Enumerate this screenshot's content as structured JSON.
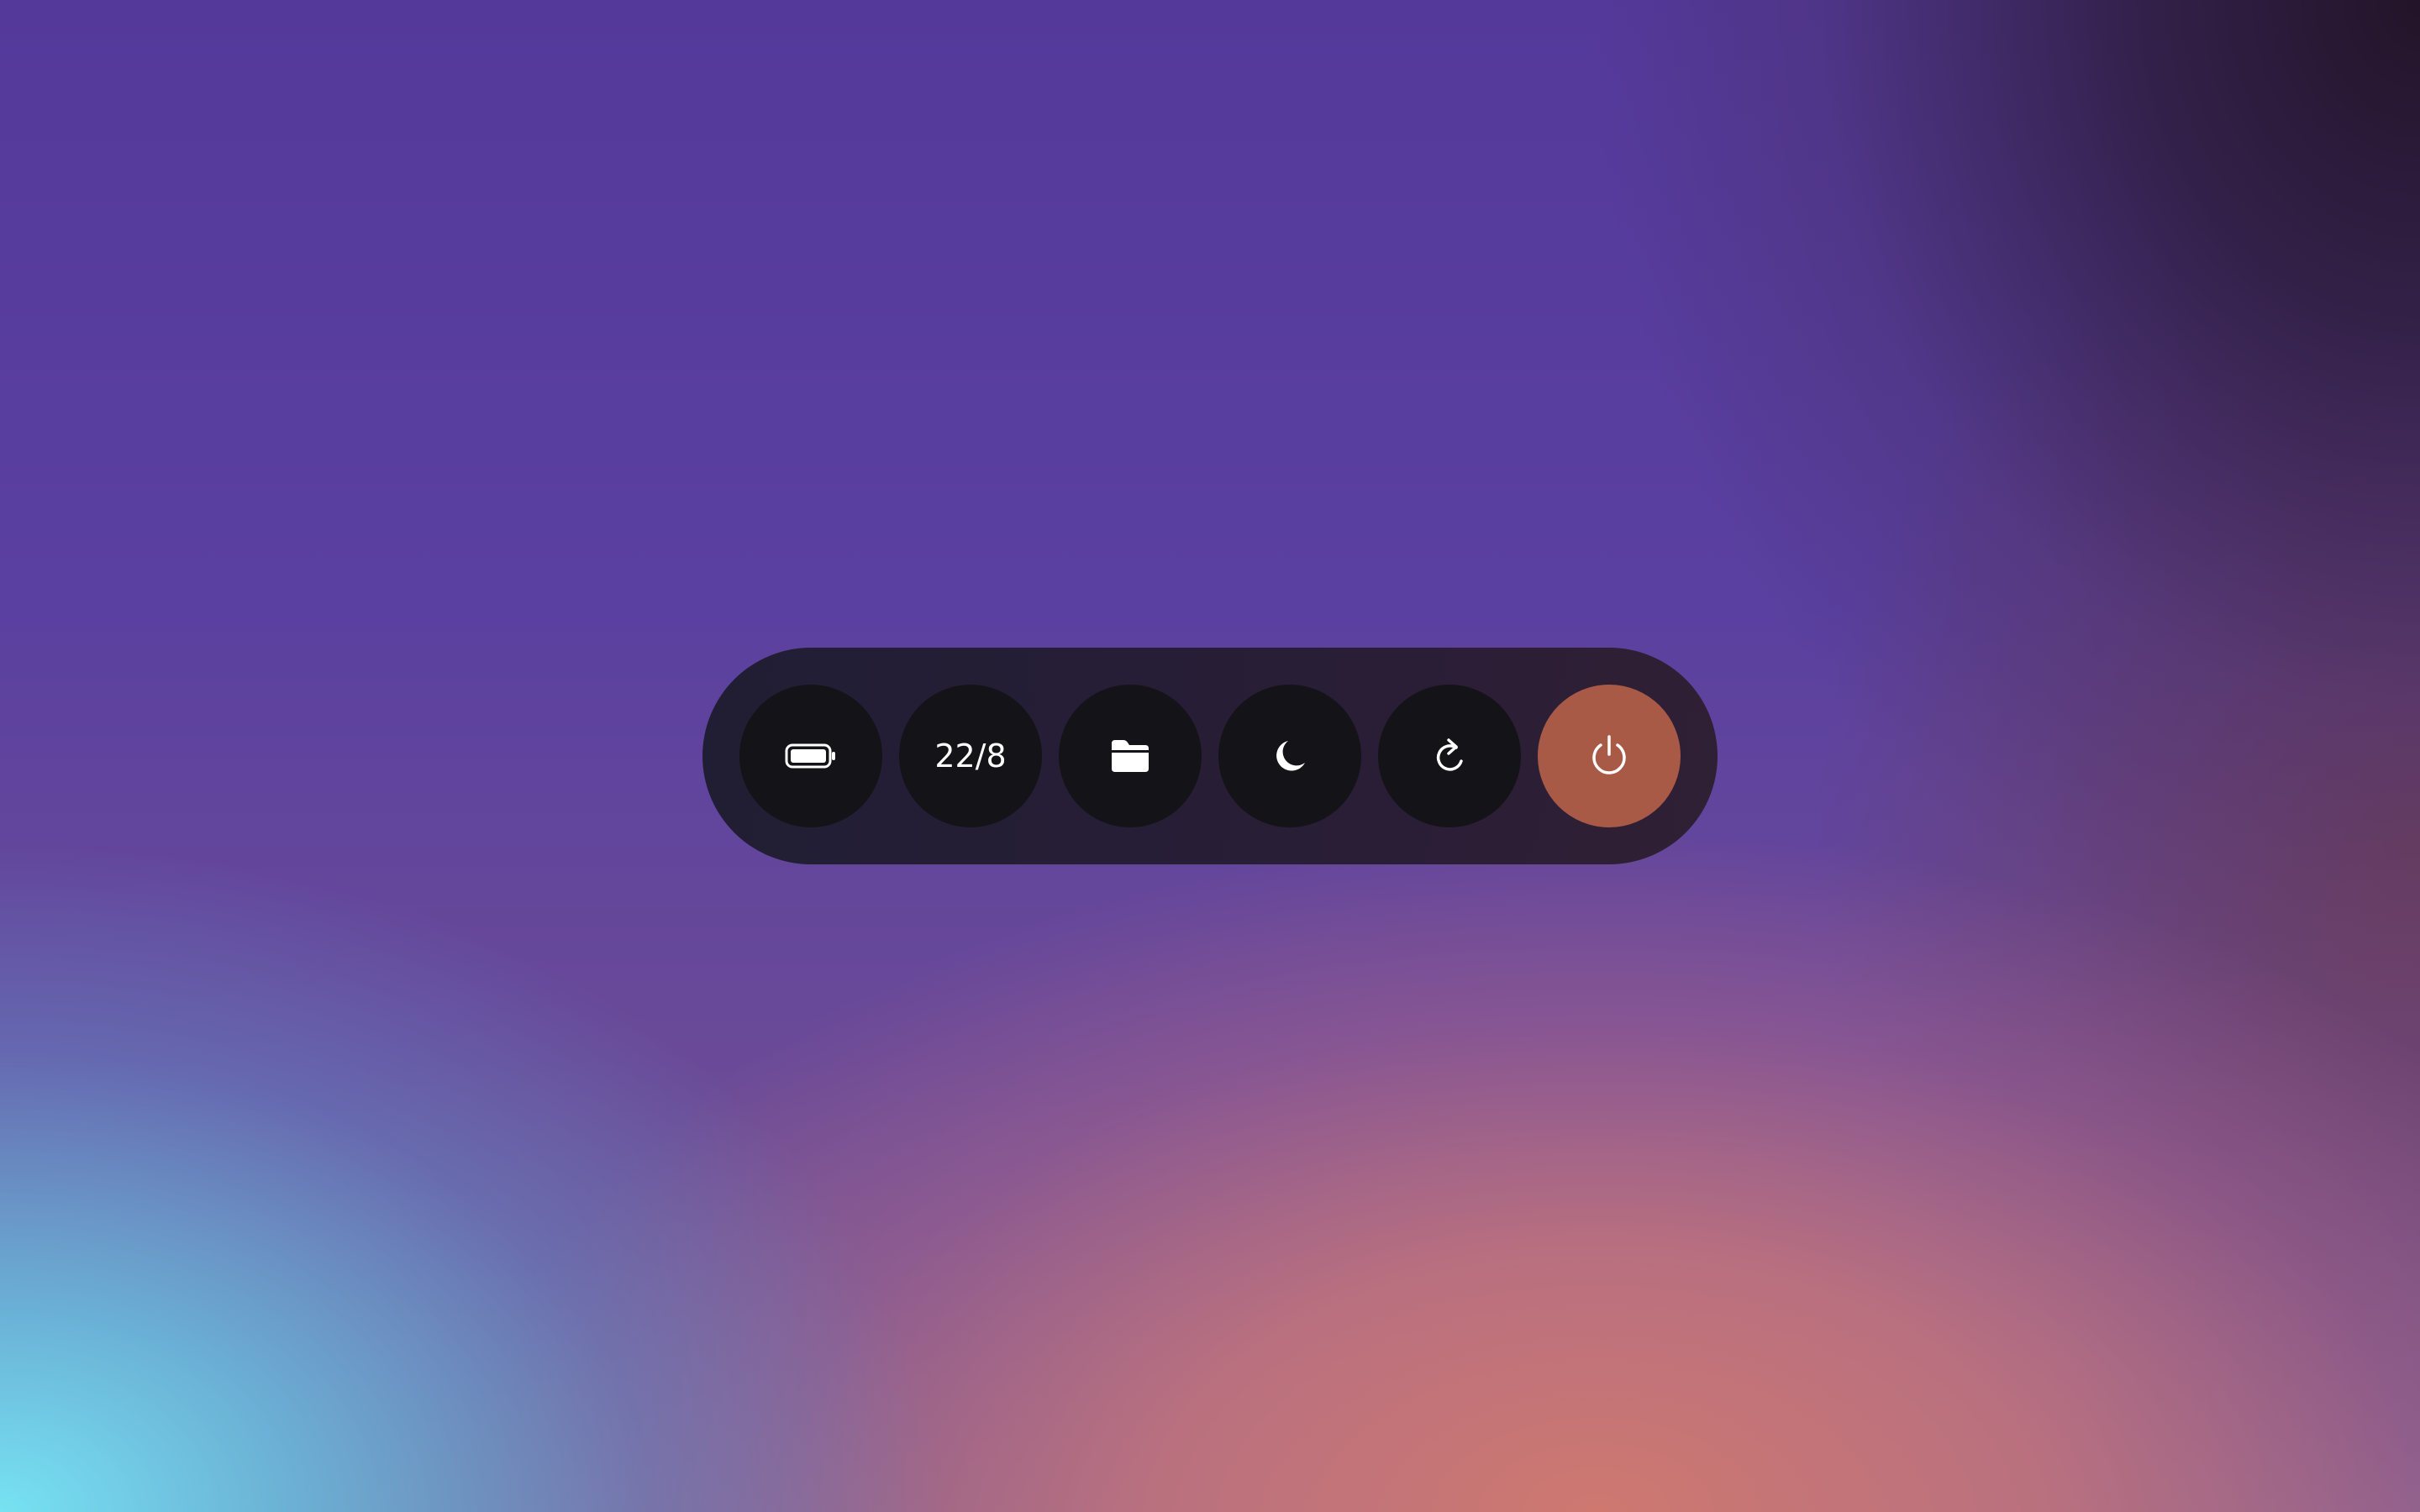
{
  "dock": {
    "buttons": [
      {
        "id": "battery",
        "icon": "battery-icon",
        "label": ""
      },
      {
        "id": "date",
        "icon": "",
        "label": "22/8"
      },
      {
        "id": "files",
        "icon": "folder-icon",
        "label": ""
      },
      {
        "id": "sleep",
        "icon": "moon-icon",
        "label": ""
      },
      {
        "id": "restart",
        "icon": "restart-icon",
        "label": ""
      },
      {
        "id": "power",
        "icon": "power-icon",
        "label": ""
      }
    ]
  },
  "colors": {
    "dock_background": "#1e1c30",
    "button_background": "#141318",
    "power_accent": "#a85a46",
    "icon_color": "#ffffff"
  }
}
